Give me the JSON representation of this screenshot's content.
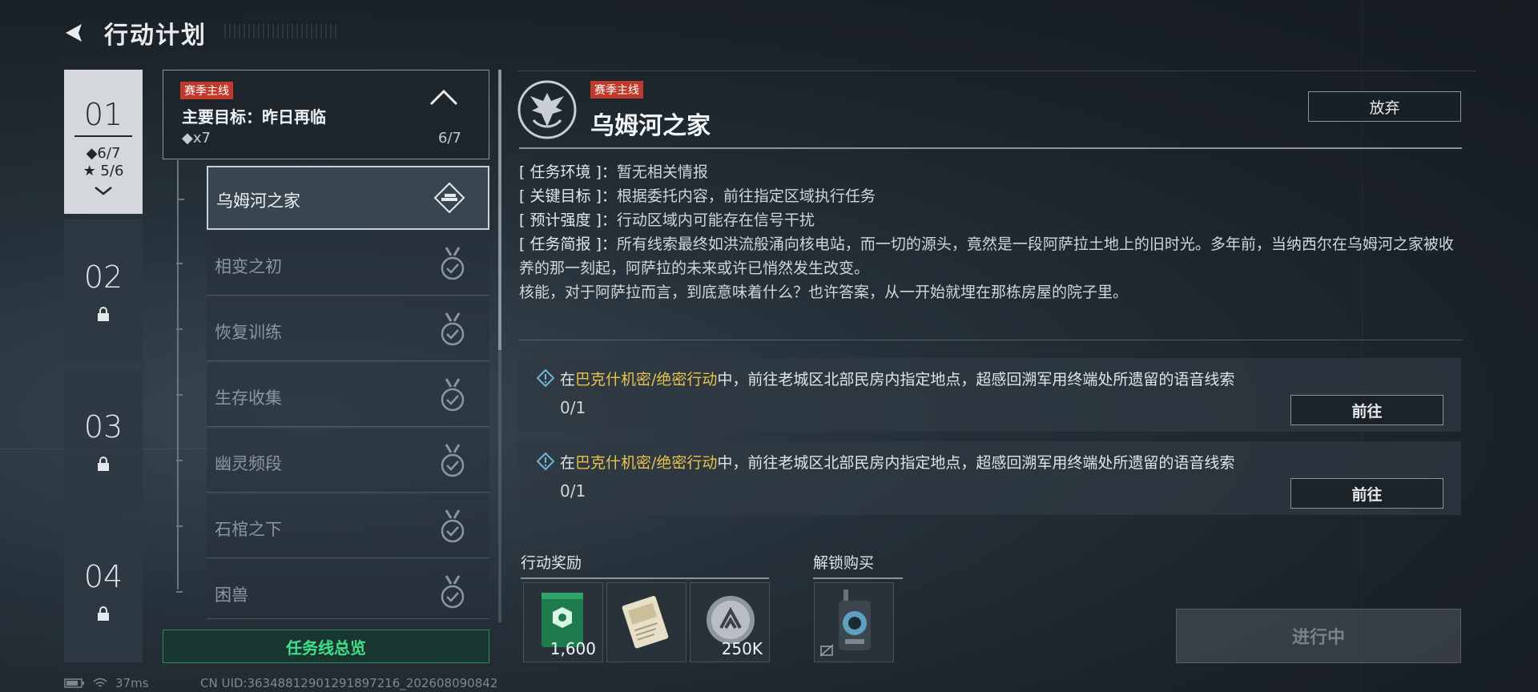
{
  "header": {
    "title": "行动计划"
  },
  "chapters": [
    {
      "num": "01",
      "stat1": "◆6/7",
      "stat2": "★ 5/6"
    },
    {
      "num": "02"
    },
    {
      "num": "03"
    },
    {
      "num": "04"
    }
  ],
  "mainline": {
    "tag": "赛季主线",
    "goal": "主要目标：昨日再临",
    "sub": "◆x7",
    "progress": "6/7"
  },
  "missions": [
    {
      "name": "乌姆河之家"
    },
    {
      "name": "相变之初"
    },
    {
      "name": "恢复训练"
    },
    {
      "name": "生存收集"
    },
    {
      "name": "幽灵频段"
    },
    {
      "name": "石棺之下"
    },
    {
      "name": "困兽"
    }
  ],
  "overview_label": "任务线总览",
  "detail": {
    "tag": "赛季主线",
    "title": "乌姆河之家",
    "abandon": "放弃",
    "info": [
      {
        "label": "[ 任务环境 ]：",
        "text": "暂无相关情报"
      },
      {
        "label": "[ 关键目标 ]：",
        "text": "根据委托内容，前往指定区域执行任务"
      },
      {
        "label": "[ 预计强度 ]：",
        "text": "行动区域内可能存在信号干扰"
      },
      {
        "label": "[ 任务简报 ]：",
        "text": "所有线索最终如洪流般涌向核电站，而一切的源头，竟然是一段阿萨拉土地上的旧时光。多年前，当纳西尔在乌姆河之家被收养的那一刻起，阿萨拉的未来或许已悄然发生改变。"
      }
    ],
    "info_extra": "核能，对于阿萨拉而言，到底意味着什么？也许答案，从一开始就埋在那栋房屋的院子里。"
  },
  "tasks": [
    {
      "pre": "在",
      "highlight": "巴克什机密/绝密行动",
      "post": "中，前往老城区北部民房内指定地点，超感回溯军用终端处所遗留的语音线索",
      "progress": "0/1",
      "button": "前往"
    },
    {
      "pre": "在",
      "highlight": "巴克什机密/绝密行动",
      "post": "中，前往老城区北部民房内指定地点，超感回溯军用终端处所遗留的语音线索",
      "progress": "0/1",
      "button": "前往"
    }
  ],
  "rewards_label": "行动奖励",
  "rewards": [
    {
      "qty": "1,600",
      "icon": "green-card-icon"
    },
    {
      "qty": "",
      "icon": "document-icon"
    },
    {
      "qty": "250K",
      "icon": "coin-icon"
    }
  ],
  "unlock_label": "解锁购买",
  "status_button": "进行中",
  "footer": {
    "ping": "37ms",
    "uid": "CN UID:3634881290129189​7216_202608090842"
  },
  "colors": {
    "accent_green": "#3ee08a",
    "tag_red": "#c0392b",
    "highlight_yellow": "#e6c350"
  }
}
